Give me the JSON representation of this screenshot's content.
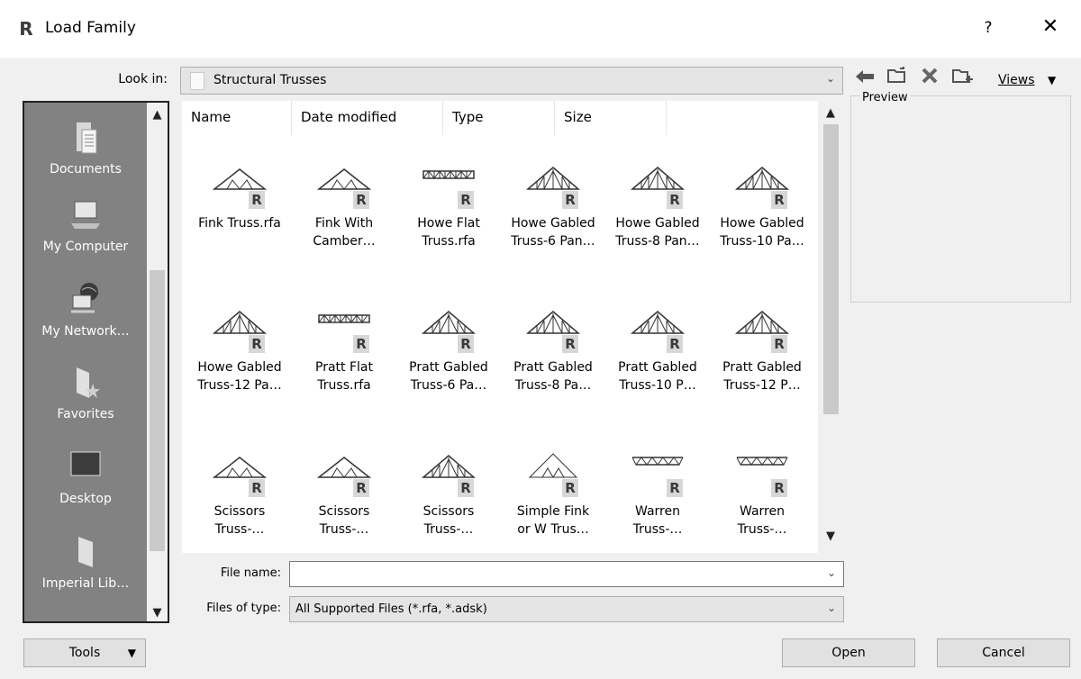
{
  "window": {
    "title": "Load Family",
    "app_logo": "R",
    "help_label": "?",
    "close_label": "✕"
  },
  "look_in": {
    "label": "Look in:",
    "value": "Structural Trusses"
  },
  "toolbar": {
    "views_label": "Views"
  },
  "places": [
    {
      "label": "Documents",
      "icon": "documents-icon"
    },
    {
      "label": "My Computer",
      "icon": "computer-icon"
    },
    {
      "label": "My Network…",
      "icon": "network-icon"
    },
    {
      "label": "Favorites",
      "icon": "favorites-icon"
    },
    {
      "label": "Desktop",
      "icon": "desktop-icon"
    },
    {
      "label": "Imperial Lib…",
      "icon": "folder-icon"
    }
  ],
  "columns": [
    "Name",
    "Date modified",
    "Type",
    "Size"
  ],
  "files": [
    {
      "name": "Fink Truss.rfa",
      "kind": "fink"
    },
    {
      "name": "Fink With\nCamber…",
      "kind": "fink"
    },
    {
      "name": "Howe Flat\nTruss.rfa",
      "kind": "flat"
    },
    {
      "name": "Howe Gabled\nTruss-6 Pan…",
      "kind": "gabled"
    },
    {
      "name": "Howe Gabled\nTruss-8 Pan…",
      "kind": "gabled"
    },
    {
      "name": "Howe Gabled\nTruss-10 Pa…",
      "kind": "gabled"
    },
    {
      "name": "Howe Gabled\nTruss-12 Pa…",
      "kind": "gabled"
    },
    {
      "name": "Pratt Flat\nTruss.rfa",
      "kind": "flat"
    },
    {
      "name": "Pratt Gabled\nTruss-6 Pa…",
      "kind": "gabled"
    },
    {
      "name": "Pratt Gabled\nTruss-8 Pa…",
      "kind": "gabled"
    },
    {
      "name": "Pratt Gabled\nTruss-10 P…",
      "kind": "gabled"
    },
    {
      "name": "Pratt Gabled\nTruss-12 P…",
      "kind": "gabled"
    },
    {
      "name": "Scissors\nTruss-…",
      "kind": "fink"
    },
    {
      "name": "Scissors\nTruss-…",
      "kind": "fink"
    },
    {
      "name": "Scissors\nTruss-…",
      "kind": "gabled"
    },
    {
      "name": "Simple Fink\nor W Trus…",
      "kind": "simple"
    },
    {
      "name": "Warren\nTruss-…",
      "kind": "warren"
    },
    {
      "name": "Warren\nTruss-…",
      "kind": "warren"
    }
  ],
  "file_badge": "R",
  "preview": {
    "label": "Preview"
  },
  "file_name": {
    "label": "File name:",
    "value": ""
  },
  "files_of_type": {
    "label": "Files of type:",
    "value": "All Supported Files  (*.rfa, *.adsk)"
  },
  "buttons": {
    "tools": "Tools",
    "open": "Open",
    "cancel": "Cancel"
  }
}
